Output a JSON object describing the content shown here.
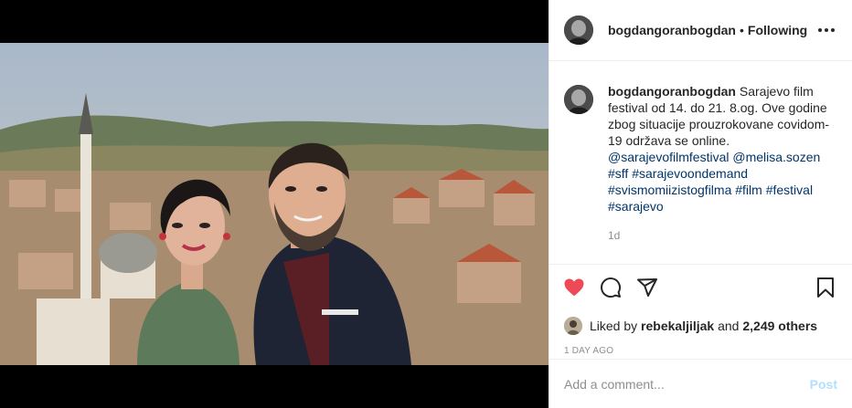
{
  "photo": {
    "alt_subject": "photo"
  },
  "header": {
    "username": "bogdangoranbogdan",
    "separator": "•",
    "follow_status": "Following",
    "more_icon": "more-horizontal-icon"
  },
  "caption": {
    "author": "bogdangoranbogdan",
    "text": "Sarajevo film festival od 14. do 21. 8.og. Ove godine zbog situacije prouzrokovane covidom-19 održava se online.",
    "mentions": [
      "@sarajevofilmfestival",
      "@melisa.sozen"
    ],
    "hashtags": [
      "#sff",
      "#sarajevoondemand",
      "#svismomiizistogfilma",
      "#film",
      "#festival",
      "#sarajevo"
    ],
    "time_ago": "1d"
  },
  "actions": {
    "icons": [
      "heart-filled-icon",
      "comment-icon",
      "share-icon",
      "bookmark-icon"
    ],
    "liked": true,
    "like_color": "#ed4956"
  },
  "likes": {
    "prefix": "Liked by",
    "user": "rebekaljiljak",
    "and": "and",
    "others": "2,249 others"
  },
  "date": "1 DAY AGO",
  "comment": {
    "placeholder": "Add a comment...",
    "post_label": "Post",
    "post_color": "#b2dffc"
  }
}
